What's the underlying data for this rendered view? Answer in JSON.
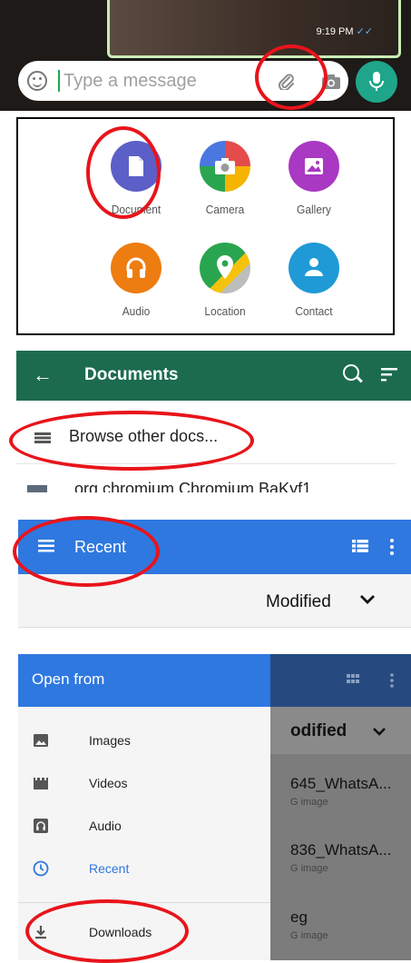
{
  "chat": {
    "timestamp": "9:19 PM",
    "placeholder": "Type a message",
    "icons": [
      "emoji-icon",
      "paperclip-icon",
      "camera-icon",
      "mic-icon"
    ],
    "accent_color": "#1fa58a"
  },
  "attach_menu": {
    "items": [
      {
        "label": "Document",
        "color": "#5c5fc7",
        "icon": "document-icon"
      },
      {
        "label": "Camera",
        "color": "#e54b4b",
        "icon": "camera-icon"
      },
      {
        "label": "Gallery",
        "color": "#a938c2",
        "icon": "gallery-icon"
      },
      {
        "label": "Audio",
        "color": "#ee7d11",
        "icon": "headphones-icon"
      },
      {
        "label": "Location",
        "color": "#2aa54f",
        "icon": "location-pin-icon"
      },
      {
        "label": "Contact",
        "color": "#1f9ad6",
        "icon": "contact-icon"
      }
    ]
  },
  "documents": {
    "title": "Documents",
    "browse_label": "Browse other docs...",
    "file_name": "org.chromium.Chromium.BaKyf1",
    "header_color": "#1c6b4f"
  },
  "recent": {
    "title": "Recent",
    "sort_label": "Modified",
    "header_color": "#2f78e0"
  },
  "drawer": {
    "title": "Open from",
    "items": [
      {
        "label": "Images",
        "icon": "image-icon"
      },
      {
        "label": "Videos",
        "icon": "video-icon"
      },
      {
        "label": "Audio",
        "icon": "audio-icon"
      },
      {
        "label": "Recent",
        "icon": "clock-icon"
      },
      {
        "label": "Downloads",
        "icon": "download-icon"
      }
    ],
    "selected": "Recent",
    "background": {
      "sort_label": "odified",
      "files": [
        {
          "name": "645_WhatsA...",
          "type": "G image"
        },
        {
          "name": "836_WhatsA...",
          "type": "G image"
        },
        {
          "name": "eg",
          "type": "G image"
        }
      ]
    }
  }
}
